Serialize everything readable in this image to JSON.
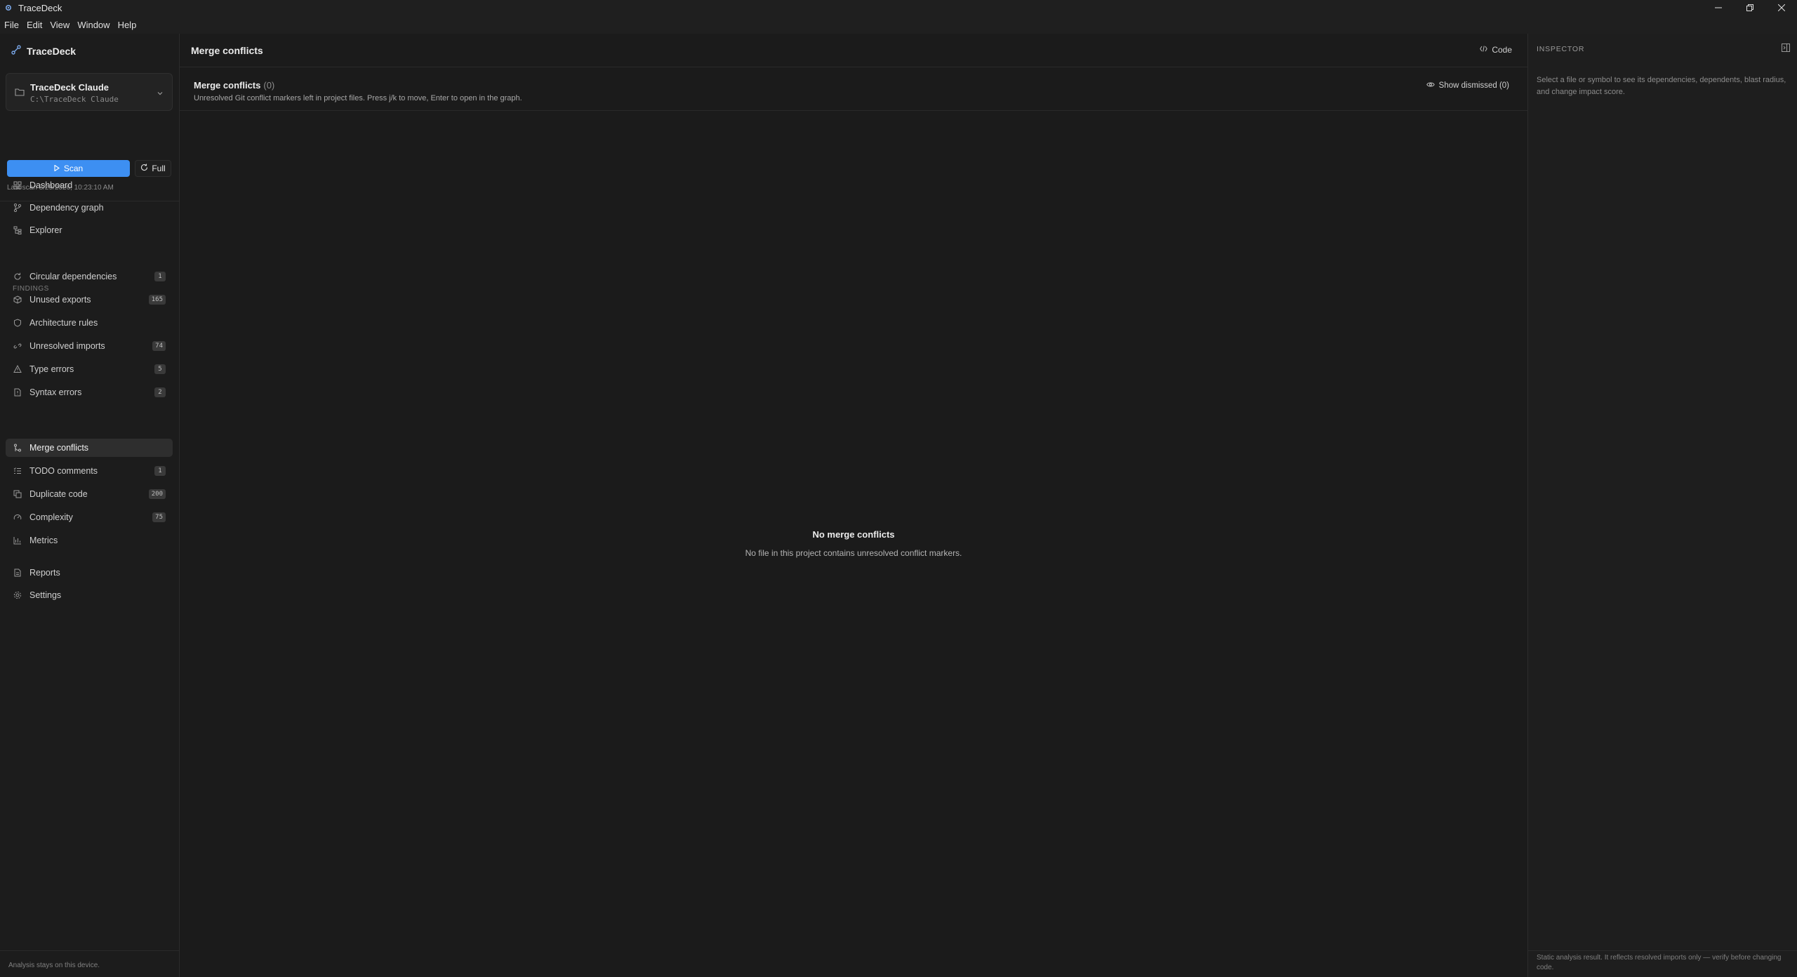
{
  "window": {
    "title": "TraceDeck"
  },
  "menu": [
    "File",
    "Edit",
    "View",
    "Window",
    "Help"
  ],
  "sidebar": {
    "brand": "TraceDeck",
    "project": {
      "name": "TraceDeck Claude",
      "path": "C:\\TraceDeck Claude"
    },
    "scan_label": "Scan",
    "full_label": "Full",
    "last_scan": "Last scan 8/29/2026, 10:23:10 AM",
    "nav": [
      {
        "label": "Dashboard"
      },
      {
        "label": "Dependency graph"
      },
      {
        "label": "Explorer"
      }
    ],
    "findings_label": "FINDINGS",
    "findings": [
      {
        "label": "Circular dependencies",
        "count": "1"
      },
      {
        "label": "Unused exports",
        "count": "165"
      },
      {
        "label": "Architecture rules",
        "count": ""
      },
      {
        "label": "Unresolved imports",
        "count": "74"
      },
      {
        "label": "Type errors",
        "count": "5"
      },
      {
        "label": "Syntax errors",
        "count": "2"
      },
      {
        "label": "Merge conflicts",
        "count": ""
      },
      {
        "label": "TODO comments",
        "count": "1"
      },
      {
        "label": "Duplicate code",
        "count": "200"
      },
      {
        "label": "Complexity",
        "count": "75"
      },
      {
        "label": "Metrics",
        "count": ""
      }
    ],
    "bottom_nav": [
      {
        "label": "Reports"
      },
      {
        "label": "Settings"
      }
    ],
    "footer": "Analysis stays on this device."
  },
  "main": {
    "title": "Merge conflicts",
    "code_label": "Code",
    "section_title": "Merge conflicts",
    "section_count": "(0)",
    "section_desc": "Unresolved Git conflict markers left in project files. Press j/k to move, Enter to open in the graph.",
    "show_dismissed": "Show dismissed (0)",
    "empty_title": "No merge conflicts",
    "empty_desc": "No file in this project contains unresolved conflict markers."
  },
  "inspector": {
    "title": "INSPECTOR",
    "hint": "Select a file or symbol to see its dependencies, dependents, blast radius, and change impact score.",
    "footer": "Static analysis result. It reflects resolved imports only — verify before changing code."
  },
  "colors": {
    "accent": "#3d8ff2",
    "background": "#1b1b1b",
    "sidebar": "#1c1c1c",
    "active_item": "#2e2e2e"
  }
}
